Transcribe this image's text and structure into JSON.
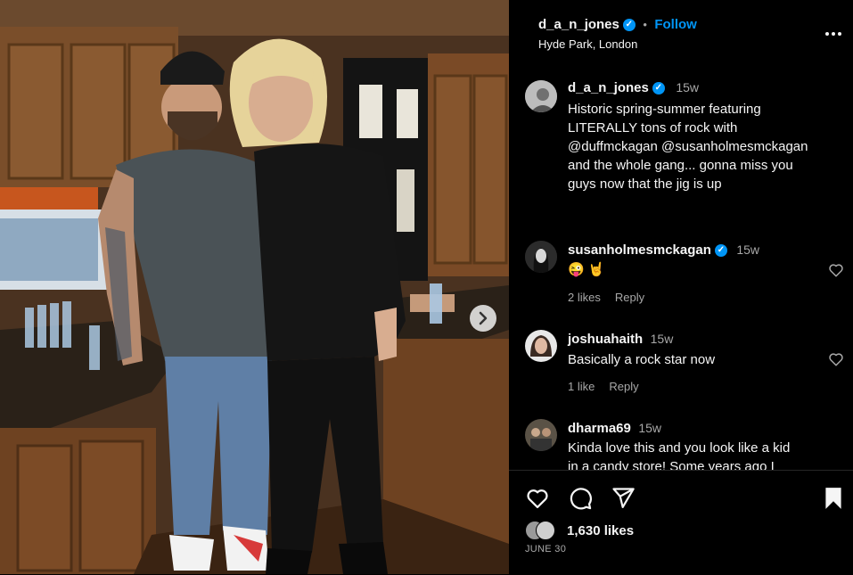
{
  "post": {
    "author": "d_a_n_jones",
    "location": "Hyde Park, London",
    "follow_label": "Follow",
    "separator": "•"
  },
  "caption": {
    "author": "d_a_n_jones",
    "time": "15w",
    "line1": "Historic spring-summer featuring",
    "line2": "LITERALLY tons of rock with",
    "line3": "@duffmckagan @susanholmesmckagan",
    "line4": "and the whole gang... gonna miss you",
    "line5": "guys now that the jig is up"
  },
  "comments": [
    {
      "user": "susanholmesmckagan",
      "verified": true,
      "time": "15w",
      "text": "😜 🤘",
      "likes": "2 likes",
      "reply": "Reply"
    },
    {
      "user": "joshuahaith",
      "verified": false,
      "time": "15w",
      "text": "Basically a rock star now",
      "likes": "1 like",
      "reply": "Reply"
    },
    {
      "user": "dharma69",
      "verified": false,
      "time": "15w",
      "line1": "Kinda love this and you look like a kid",
      "line2": "in a candy store! Some years ago I"
    }
  ],
  "footer": {
    "likes": "1,630 likes",
    "date": "JUNE 30"
  },
  "icons": [
    "more-icon",
    "heart-icon",
    "comment-icon",
    "share-icon",
    "bookmark-icon",
    "next-arrow-icon",
    "verified-icon"
  ],
  "colors": {
    "accent": "#0095f6",
    "background": "#000000",
    "text": "#f5f5f5",
    "muted": "#a8a8a8"
  }
}
